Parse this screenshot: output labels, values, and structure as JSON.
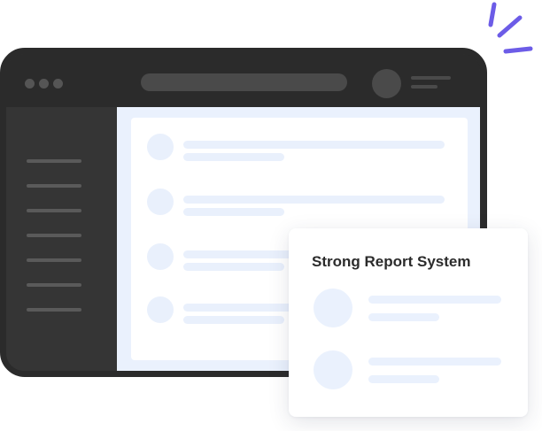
{
  "card": {
    "title": "Strong Report System"
  },
  "colors": {
    "accent": "#6c5ce7",
    "frame": "#2b2b2b",
    "sidebar": "#353535",
    "content_background": "#eaf1fd",
    "placeholder": "#e9f0fc"
  },
  "sidebar": {
    "item_count": 7
  },
  "list": {
    "row_count": 4
  }
}
